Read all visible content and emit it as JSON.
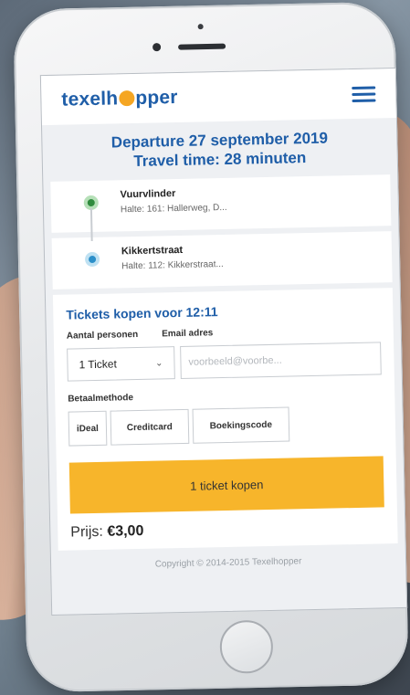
{
  "header": {
    "logo_pre": "texelh",
    "logo_post": "pper"
  },
  "heading": {
    "departure": "Departure 27 september 2019",
    "travel_time": "Travel time: 28 minuten"
  },
  "stops": [
    {
      "name": "Vuurvlinder",
      "sub": "Halte: 161: Hallerweg, D..."
    },
    {
      "name": "Kikkertstraat",
      "sub": "Halte: 112: Kikkerstraat..."
    }
  ],
  "tickets": {
    "title": "Tickets kopen voor 12:11",
    "persons_label": "Aantal personen",
    "email_label": "Email adres",
    "persons_value": "1 Ticket",
    "email_placeholder": "voorbeeld@voorbe...",
    "payment_label": "Betaalmethode",
    "payment_options": [
      "iDeal",
      "Creditcard",
      "Boekingscode"
    ],
    "buy_label": "1 ticket kopen",
    "price_label": "Prijs:",
    "price_value": "€3,00"
  },
  "footer": {
    "copyright": "Copyright © 2014-2015 Texelhopper"
  },
  "colors": {
    "brand_blue": "#1f5ea8",
    "accent_orange": "#f7b52b"
  }
}
